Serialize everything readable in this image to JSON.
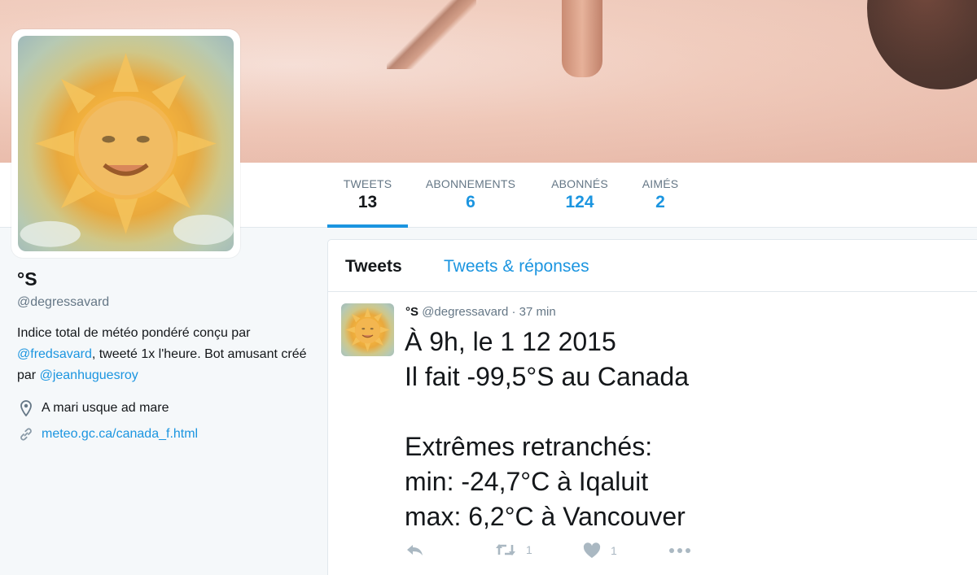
{
  "profile": {
    "name": "°S",
    "handle": "@degressavard",
    "bio_part1": "Indice total de météo pondéré conçu par ",
    "bio_link1": "@fredsavard",
    "bio_part2": ", tweeté 1x l'heure. Bot amusant créé par ",
    "bio_link2": "@jeanhuguesroy",
    "location": "A mari usque ad mare",
    "website": "meteo.gc.ca/canada_f.html"
  },
  "stats": [
    {
      "label": "TWEETS",
      "value": "13"
    },
    {
      "label": "ABONNEMENTS",
      "value": "6"
    },
    {
      "label": "ABONNÉS",
      "value": "124"
    },
    {
      "label": "AIMÉS",
      "value": "2"
    }
  ],
  "timeline": {
    "tabs": [
      "Tweets",
      "Tweets & réponses"
    ]
  },
  "tweet": {
    "name": "°S",
    "handle": "@degressavard",
    "sep": " · ",
    "time": "37 min",
    "text": "À 9h, le 1 12 2015\nIl fait -99,5°S au Canada\n\nExtrêmes retranchés:\nmin: -24,7°C à Iqaluit\nmax: 6,2°C à Vancouver",
    "retweets": "1",
    "likes": "1"
  },
  "colors": {
    "accent": "#1b95e0",
    "muted": "#657786",
    "icon": "#aab8c2",
    "background": "#f5f8fa"
  },
  "icons": [
    "location-pin-icon",
    "link-icon",
    "reply-icon",
    "retweet-icon",
    "heart-icon",
    "more-icon"
  ]
}
